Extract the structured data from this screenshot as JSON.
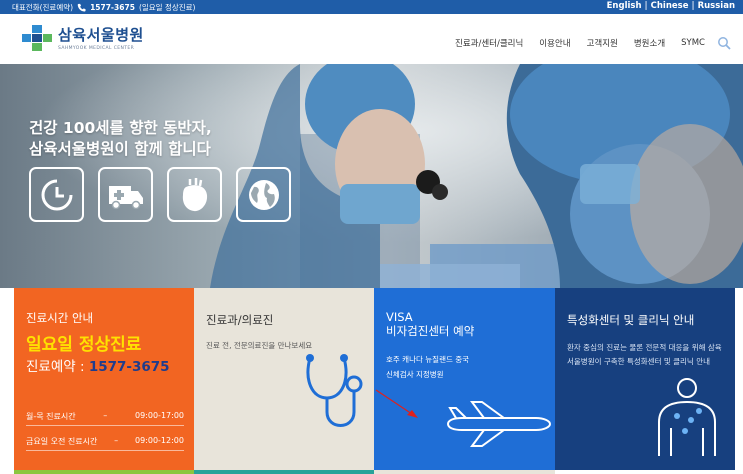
{
  "topbar": {
    "phone_label": "대표전화(진료예약)",
    "phone_number": "1577-3675",
    "phone_note": "(일요일 정상진료)",
    "languages": [
      "English",
      "Chinese",
      "Russian"
    ]
  },
  "logo": {
    "name_ko": "삼육서울병원",
    "name_en": "SAHMYOOK MEDICAL CENTER"
  },
  "nav": [
    "진료과/센터/클리닉",
    "이용안내",
    "고객지원",
    "병원소개",
    "SYMC"
  ],
  "hero": {
    "line1": "건강 100세를 향한 동반자,",
    "line2": "삼육서울병원이 함께 합니다"
  },
  "tiles": {
    "hours": {
      "title": "진료시간 안내",
      "sunday": "일요일 정상진료",
      "reserve_label": "진료예약 : ",
      "reserve_number": "1577-3675",
      "rows": [
        {
          "label": "월-목 진료시간",
          "dash": "–",
          "time": "09:00-17:00"
        },
        {
          "label": "금요일 오전 진료시간",
          "dash": "–",
          "time": "09:00-12:00"
        }
      ]
    },
    "departments": {
      "title": "진료과/의료진",
      "desc": "진료 전, 전문의료진을 만나보세요"
    },
    "visa": {
      "title1": "VISA",
      "title2": "비자검진센터 예약",
      "desc1": "호주 캐나다 뉴질랜드 중국",
      "desc2": "신체검사 지정병원"
    },
    "special": {
      "title": "특성화센터 및 클리닉 안내",
      "desc": "환자 중심의 진료는 물론 전문적 대응을 위해 삼육서울병원이 구축한 특성화센터 및 클리닉 안내"
    }
  },
  "colors": {
    "topbar": "#1f5da8",
    "orange": "#f26522",
    "yellow": "#ffe100",
    "blue": "#1f6ed6",
    "navy": "#17407f",
    "beige": "#e8e4da"
  },
  "icons": [
    "phone-icon",
    "search-icon",
    "clock-icon",
    "ambulance-icon",
    "heart-icon",
    "globe-icon",
    "stethoscope-icon",
    "airplane-icon",
    "body-icon"
  ]
}
